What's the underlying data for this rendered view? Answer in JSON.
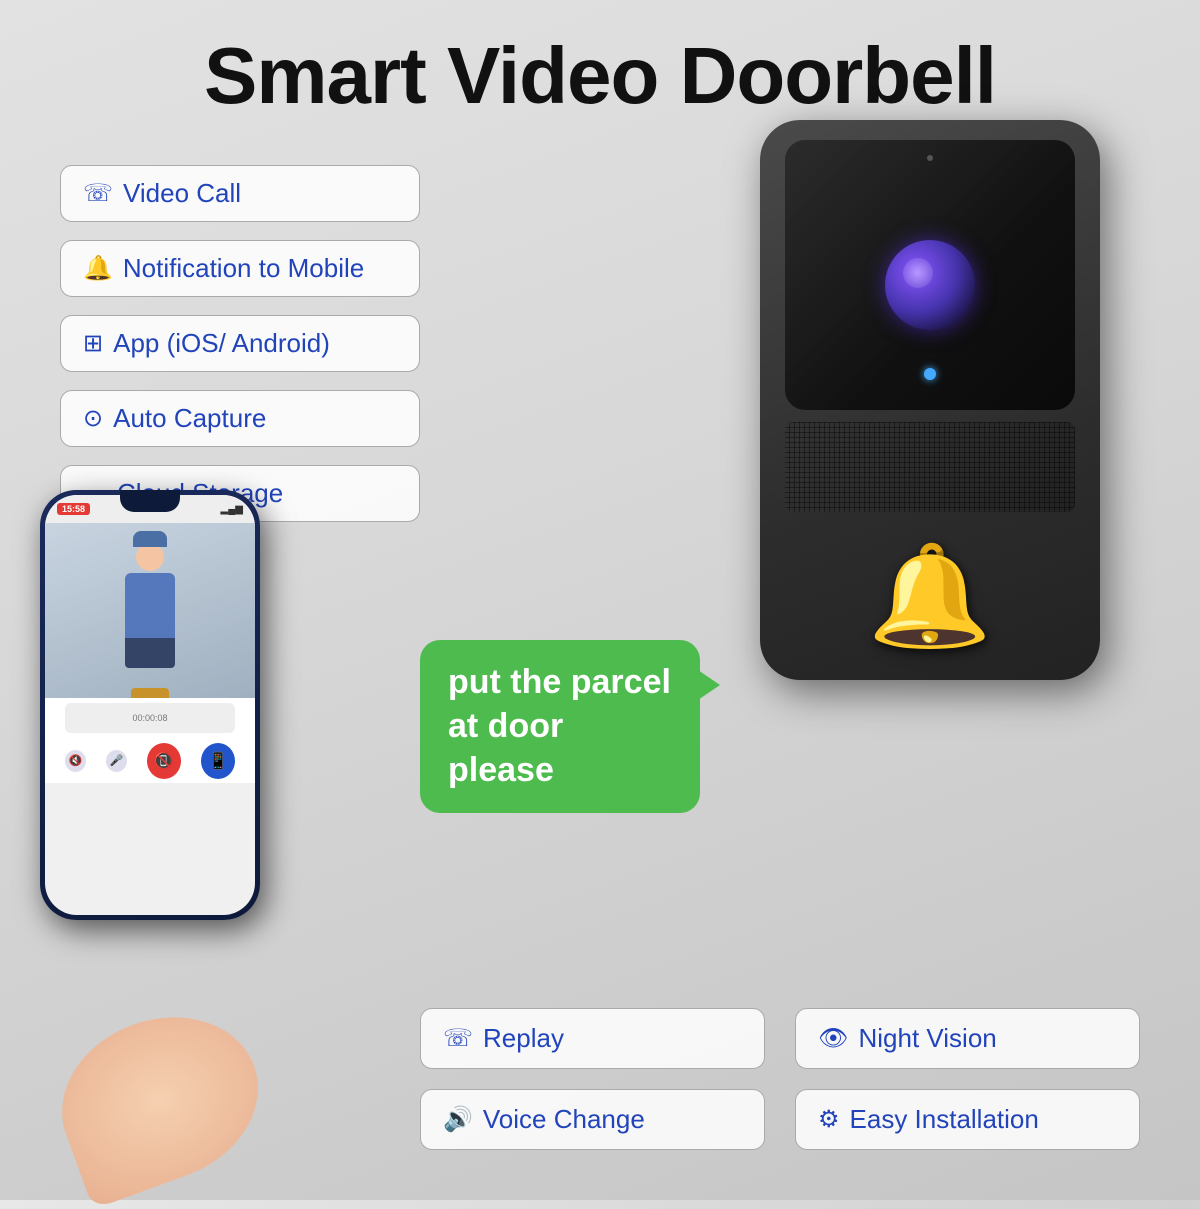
{
  "title": "Smart Video Doorbell",
  "features_left": [
    {
      "id": "video-call",
      "icon": "📞",
      "label": "Video Call"
    },
    {
      "id": "notification",
      "icon": "🔔",
      "label": "Notification to Mobile"
    },
    {
      "id": "app",
      "icon": "⊞",
      "label": "App (iOS/ Android)"
    },
    {
      "id": "auto-capture",
      "icon": "▶",
      "label": "Auto Capture"
    },
    {
      "id": "cloud-storage",
      "icon": "☁",
      "label": "Cloud Storage"
    }
  ],
  "speech_bubble": {
    "line1": "put the parcel",
    "line2": "at door please"
  },
  "features_bottom": [
    {
      "id": "replay",
      "icon": "📞",
      "label": "Replay"
    },
    {
      "id": "night-vision",
      "icon": "👁",
      "label": "Night Vision"
    },
    {
      "id": "voice-change",
      "icon": "🔊",
      "label": "Voice Change"
    },
    {
      "id": "easy-installation",
      "icon": "⚙",
      "label": "Easy Installation"
    }
  ],
  "phone": {
    "time": "15:58",
    "signal": "▂▄▆"
  }
}
